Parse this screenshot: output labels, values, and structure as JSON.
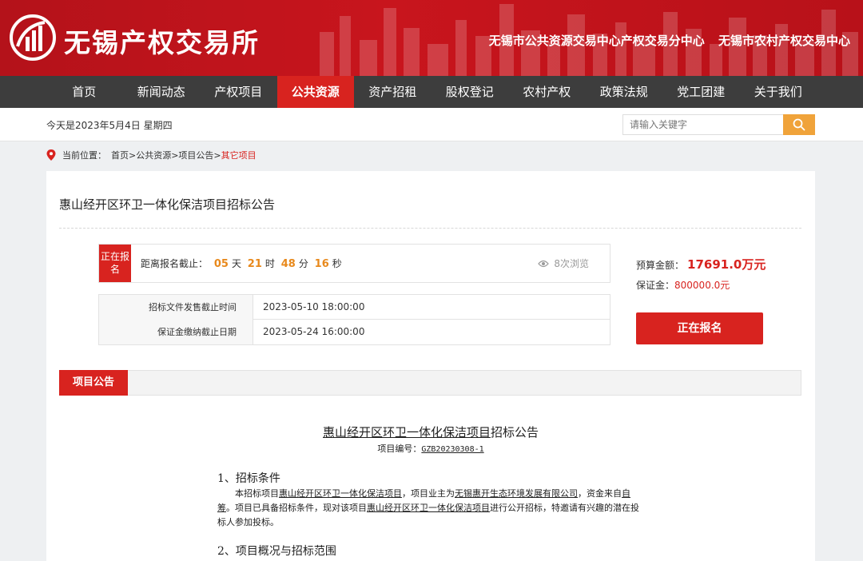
{
  "site": {
    "logo_text": "无锡产权交易所",
    "org_links": [
      "无锡市公共资源交易中心产权交易分中心",
      "无锡市农村产权交易中心"
    ]
  },
  "nav": {
    "items": [
      "首页",
      "新闻动态",
      "产权项目",
      "公共资源",
      "资产招租",
      "股权登记",
      "农村产权",
      "政策法规",
      "党工团建",
      "关于我们"
    ],
    "active": "公共资源"
  },
  "infobar": {
    "today": "今天是2023年5月4日 星期四",
    "search_placeholder": "请输入关键字"
  },
  "breadcrumb": {
    "prefix": "当前位置：",
    "path": "首页>公共资源>项目公告>",
    "current": "其它项目"
  },
  "project": {
    "title": "惠山经开区环卫一体化保洁项目招标公告",
    "status": "正在报名",
    "countdown": {
      "label": "距离报名截止：",
      "days": "05",
      "days_unit": "天",
      "hours": "21",
      "hours_unit": "时",
      "minutes": "48",
      "minutes_unit": "分",
      "seconds": "16",
      "seconds_unit": "秒"
    },
    "views": "8次浏览",
    "dates": [
      {
        "label": "招标文件发售截止时间",
        "value": "2023-05-10 18:00:00"
      },
      {
        "label": "保证金缴纳截止日期",
        "value": "2023-05-24 16:00:00"
      }
    ],
    "budget_label": "预算金额：",
    "budget_value": "17691.0万元",
    "deposit_label": "保证金：",
    "deposit_value": "800000.0元",
    "signup_button": "正在报名"
  },
  "section": {
    "tab": "项目公告"
  },
  "document": {
    "title_underlined": "惠山经开区环卫一体化保洁项目",
    "title_suffix": "招标公告",
    "code_label": "项目编号：",
    "code_value": "GZB20230308-1",
    "h1": "1、招标条件",
    "p1_a": "本招标项目",
    "p1_b": "惠山经开区环卫一体化保洁项目",
    "p1_c": "，项目业主为",
    "p1_d": "无锡惠开生态环境发展有限公司",
    "p1_e": "，资金来自",
    "p1_f": "自筹",
    "p1_g": "。项目已具备招标条件，现对该项目",
    "p1_h": "惠山经开区环卫一体化保洁项目",
    "p1_i": "进行公开招标，特邀请有兴趣的潜在投标人参加投标。",
    "h2": "2、项目概况与招标范围"
  },
  "colors": {
    "brand_red": "#d8231f",
    "nav_bg": "#3d3d3d",
    "countdown_orange": "#e8891c",
    "search_orange": "#f0a33a"
  },
  "icons": {
    "logo": "building-chart-logo-icon",
    "search": "search-icon",
    "location": "location-pin-icon",
    "views": "eye-icon"
  }
}
